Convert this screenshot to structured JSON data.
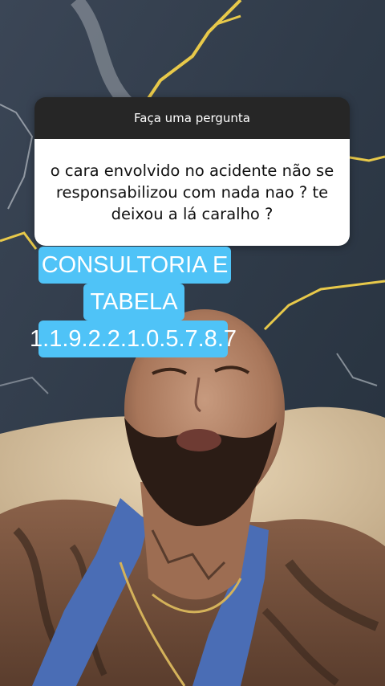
{
  "question_sticker": {
    "header": "Faça uma pergunta",
    "question": "o cara envolvido no acidente não se responsabilizou com nada nao ? te deixou a lá caralho ?"
  },
  "caption": {
    "lines": [
      "CONSULTORIA E",
      "TABELA",
      "1.1.9.2.2.1.0.5.7.8.7"
    ],
    "background_color": "#4fc3f7",
    "text_color": "#ffffff"
  }
}
